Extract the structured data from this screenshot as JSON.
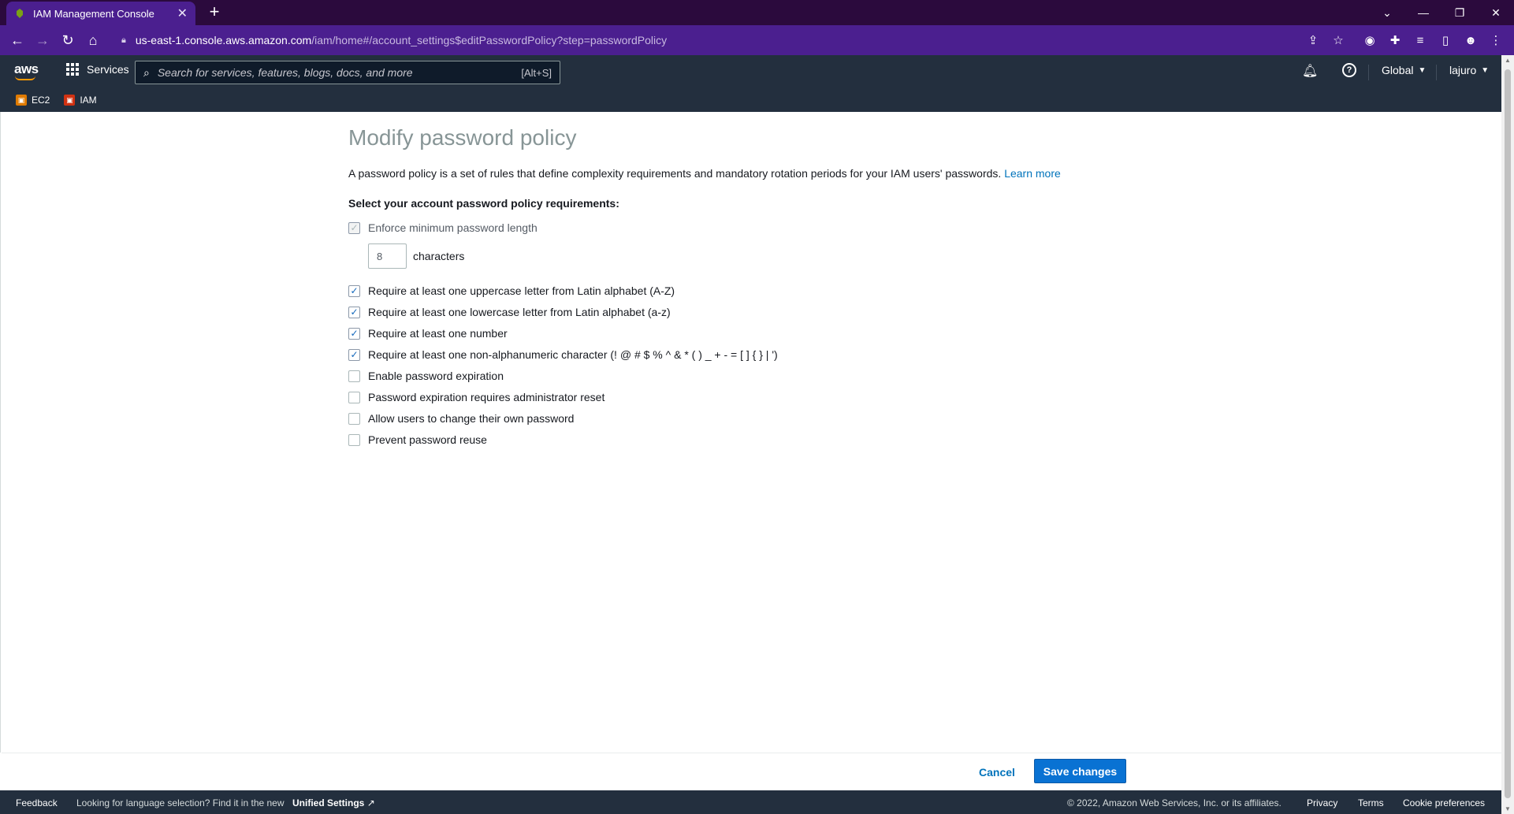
{
  "browser": {
    "tab_title": "IAM Management Console",
    "tab_close": "✕",
    "new_tab": "+",
    "url_host": "us-east-1.console.aws.amazon.com",
    "url_path": "/iam/home#/account_settings$editPasswordPolicy?step=passwordPolicy"
  },
  "aws_header": {
    "logo_text": "aws",
    "services_label": "Services",
    "search_placeholder": "Search for services, features, blogs, docs, and more",
    "search_shortcut": "[Alt+S]",
    "region_label": "Global",
    "account_label": "lajuro"
  },
  "favorites": [
    {
      "label": "EC2",
      "color": "#e07b00"
    },
    {
      "label": "IAM",
      "color": "#d13212"
    }
  ],
  "page": {
    "title": "Modify password policy",
    "description": "A password policy is a set of rules that define complexity requirements and mandatory rotation periods for your IAM users' passwords.",
    "learn_more": "Learn more",
    "subheading": "Select your account password policy requirements:",
    "min_length_label": "Enforce minimum password length",
    "min_length_value": "8",
    "min_length_unit": "characters",
    "options": [
      {
        "label": "Require at least one uppercase letter from Latin alphabet (A-Z)",
        "checked": true
      },
      {
        "label": "Require at least one lowercase letter from Latin alphabet (a-z)",
        "checked": true
      },
      {
        "label": "Require at least one number",
        "checked": true
      },
      {
        "label": "Require at least one non-alphanumeric character (! @ # $ % ^ & * ( ) _ + - = [ ] { } | ')",
        "checked": true
      },
      {
        "label": "Enable password expiration",
        "checked": false
      },
      {
        "label": "Password expiration requires administrator reset",
        "checked": false
      },
      {
        "label": "Allow users to change their own password",
        "checked": false
      },
      {
        "label": "Prevent password reuse",
        "checked": false
      }
    ],
    "cancel_label": "Cancel",
    "save_label": "Save changes"
  },
  "footer": {
    "feedback": "Feedback",
    "language_text": "Looking for language selection? Find it in the new",
    "unified_settings": "Unified Settings",
    "copyright": "© 2022, Amazon Web Services, Inc. or its affiliates.",
    "privacy": "Privacy",
    "terms": "Terms",
    "cookie": "Cookie preferences"
  },
  "colors": {
    "tabbar": "#2b0a3d",
    "toolbar": "#4b1f8f",
    "aws_nav": "#232f3e",
    "primary_button": "#0972d3",
    "link": "#0073bb"
  }
}
